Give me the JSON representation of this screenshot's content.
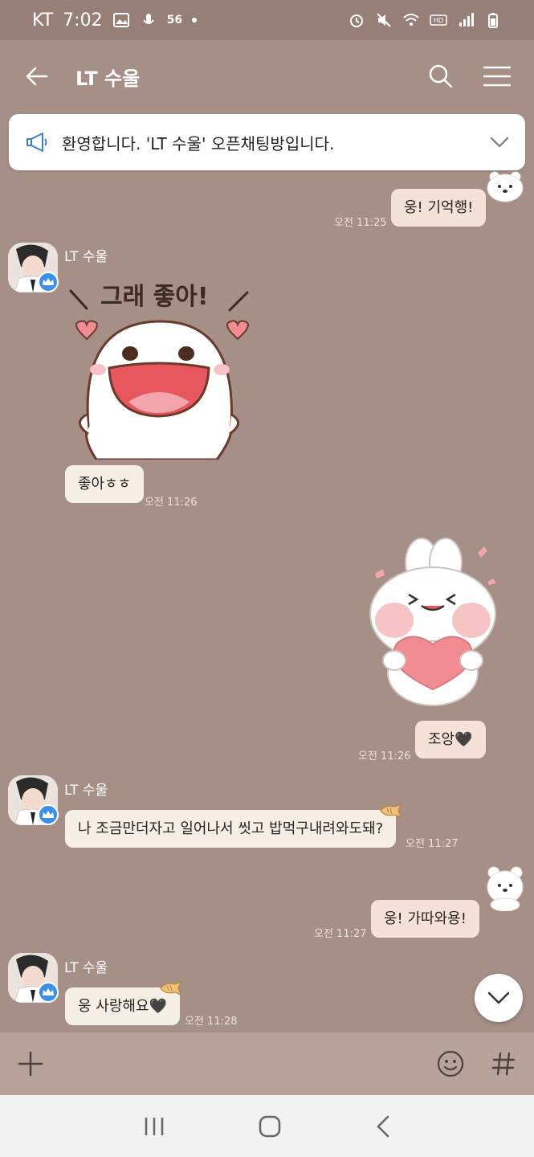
{
  "status_bar": {
    "carrier": "KT",
    "time": "7:02",
    "network": "56",
    "icons": [
      "image-icon",
      "mic-icon",
      "dot-icon",
      "alarm-icon",
      "mute-icon",
      "wifi-icon",
      "hd-icon",
      "signal-icon",
      "battery-icon"
    ]
  },
  "header": {
    "title": "LT 수울",
    "back_icon": "back-arrow-icon",
    "search_icon": "search-icon",
    "menu_icon": "menu-icon"
  },
  "notice": {
    "text": "환영합니다. 'LT 수울' 오픈채팅방입니다."
  },
  "messages": {
    "m1": {
      "text": "웅! 기억행!",
      "time": "오전 11:25"
    },
    "m2": {
      "sender": "LT 수울",
      "sticker_text": "그래 좋아!",
      "text": "좋아ㅎㅎ",
      "time": "오전 11:26"
    },
    "m3": {
      "text": "조앙🖤",
      "time": "오전 11:26"
    },
    "m4": {
      "sender": "LT 수울",
      "text": "나 조금만더자고 일어나서 씻고 밥먹구내려와도돼?",
      "time": "오전 11:27"
    },
    "m5": {
      "text": "웅! 가따와용!",
      "time": "오전 11:27"
    },
    "m6": {
      "sender": "LT 수울",
      "text": "웅 사랑해요🖤",
      "time": "오전 11:28"
    }
  },
  "colors": {
    "background": "#a58f86",
    "my_bubble": "#f4e2d8",
    "their_bubble": "#f5efe6",
    "crown_badge": "#3b8fe6"
  }
}
